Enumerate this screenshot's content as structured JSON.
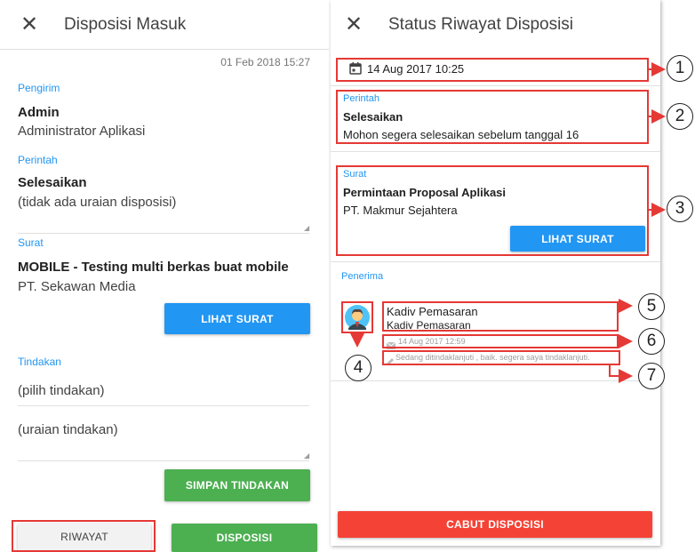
{
  "left": {
    "title": "Disposisi Masuk",
    "date": "01 Feb 2018 15:27",
    "pengirim_label": "Pengirim",
    "pengirim_name": "Admin",
    "pengirim_role": "Administrator Aplikasi",
    "perintah_label": "Perintah",
    "perintah_value": "Selesaikan",
    "perintah_desc": "(tidak ada uraian disposisi)",
    "surat_label": "Surat",
    "surat_title": "MOBILE - Testing multi berkas buat mobile",
    "surat_company": "PT. Sekawan Media",
    "lihat_surat": "LIHAT SURAT",
    "tindakan_label": "Tindakan",
    "tindakan_select": "(pilih tindakan)",
    "tindakan_textarea": "(uraian tindakan)",
    "simpan": "SIMPAN TINDAKAN",
    "riwayat": "RIWAYAT",
    "disposisi": "DISPOSISI"
  },
  "right": {
    "title": "Status Riwayat Disposisi",
    "date": "14 Aug 2017 10:25",
    "perintah_label": "Perintah",
    "perintah_value": "Selesaikan",
    "perintah_desc": "Mohon segera selesaikan sebelum tanggal 16",
    "surat_label": "Surat",
    "surat_title": "Permintaan Proposal Aplikasi",
    "surat_company": "PT. Makmur Sejahtera",
    "lihat_surat": "LIHAT SURAT",
    "penerima_label": "Penerima",
    "penerima_name": "Kadiv Pemasaran",
    "penerima_role": "Kadiv Pemasaran",
    "penerima_date": "14 Aug 2017 12:59",
    "penerima_note": "Sedang ditindaklanjuti , baik. segera saya tindaklanjuti.",
    "cabut": "CABUT DISPOSISI"
  },
  "callouts": [
    "1",
    "2",
    "3",
    "4",
    "5",
    "6",
    "7"
  ],
  "icons": {
    "close": "close-icon",
    "calendar": "calendar-icon",
    "avatar": "avatar-icon",
    "mail": "mail-icon",
    "pencil": "pencil-icon"
  },
  "colors": {
    "accent_blue": "#2196F3",
    "green": "#4CAF50",
    "red": "#F44336",
    "annotation_red": "#e53935"
  }
}
